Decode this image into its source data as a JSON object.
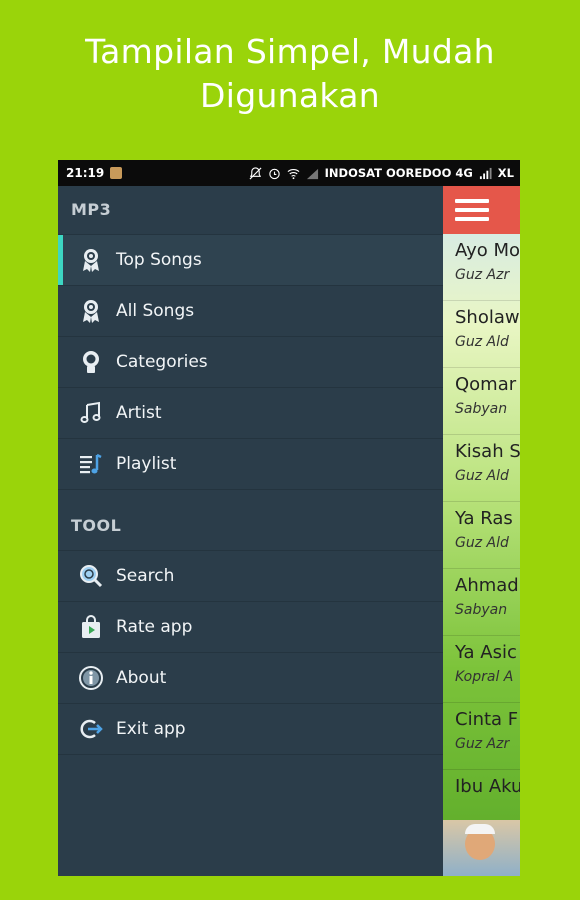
{
  "headline": {
    "line1": "Tampilan Simpel, Mudah",
    "line2": "Digunakan"
  },
  "status_bar": {
    "time": "21:19",
    "carrier": "INDOSAT OOREDOO 4G",
    "carrier2": "XL"
  },
  "drawer": {
    "section_mp3": "MP3",
    "mp3_items": [
      {
        "label": "Top Songs",
        "icon": "award-ribbon-icon",
        "active": true
      },
      {
        "label": "All Songs",
        "icon": "award-ribbon-icon",
        "active": false
      },
      {
        "label": "Categories",
        "icon": "badge-icon",
        "active": false
      },
      {
        "label": "Artist",
        "icon": "music-note-icon",
        "active": false
      },
      {
        "label": "Playlist",
        "icon": "playlist-icon",
        "active": false
      }
    ],
    "section_tool": "TOOL",
    "tool_items": [
      {
        "label": "Search",
        "icon": "search-icon"
      },
      {
        "label": "Rate app",
        "icon": "store-bag-icon"
      },
      {
        "label": "About",
        "icon": "info-icon"
      },
      {
        "label": "Exit app",
        "icon": "exit-icon"
      }
    ]
  },
  "songs": [
    {
      "title": "Ayo Mo",
      "artist": "Guz Azr"
    },
    {
      "title": "Sholaw",
      "artist": "Guz Ald"
    },
    {
      "title": "Qomar",
      "artist": "Sabyan"
    },
    {
      "title": "Kisah S",
      "artist": "Guz Ald"
    },
    {
      "title": "Ya Ras",
      "artist": "Guz Ald"
    },
    {
      "title": "Ahmad",
      "artist": "Sabyan"
    },
    {
      "title": "Ya Asic",
      "artist": "Kopral A"
    },
    {
      "title": "Cinta F",
      "artist": "Guz Azr"
    },
    {
      "title": "Ibu Aku",
      "artist": ""
    }
  ],
  "colors": {
    "background": "#9ad40a",
    "drawer": "#2b3d4a",
    "toolbar": "#e5574a",
    "active_accent": "#3dd6c2"
  }
}
